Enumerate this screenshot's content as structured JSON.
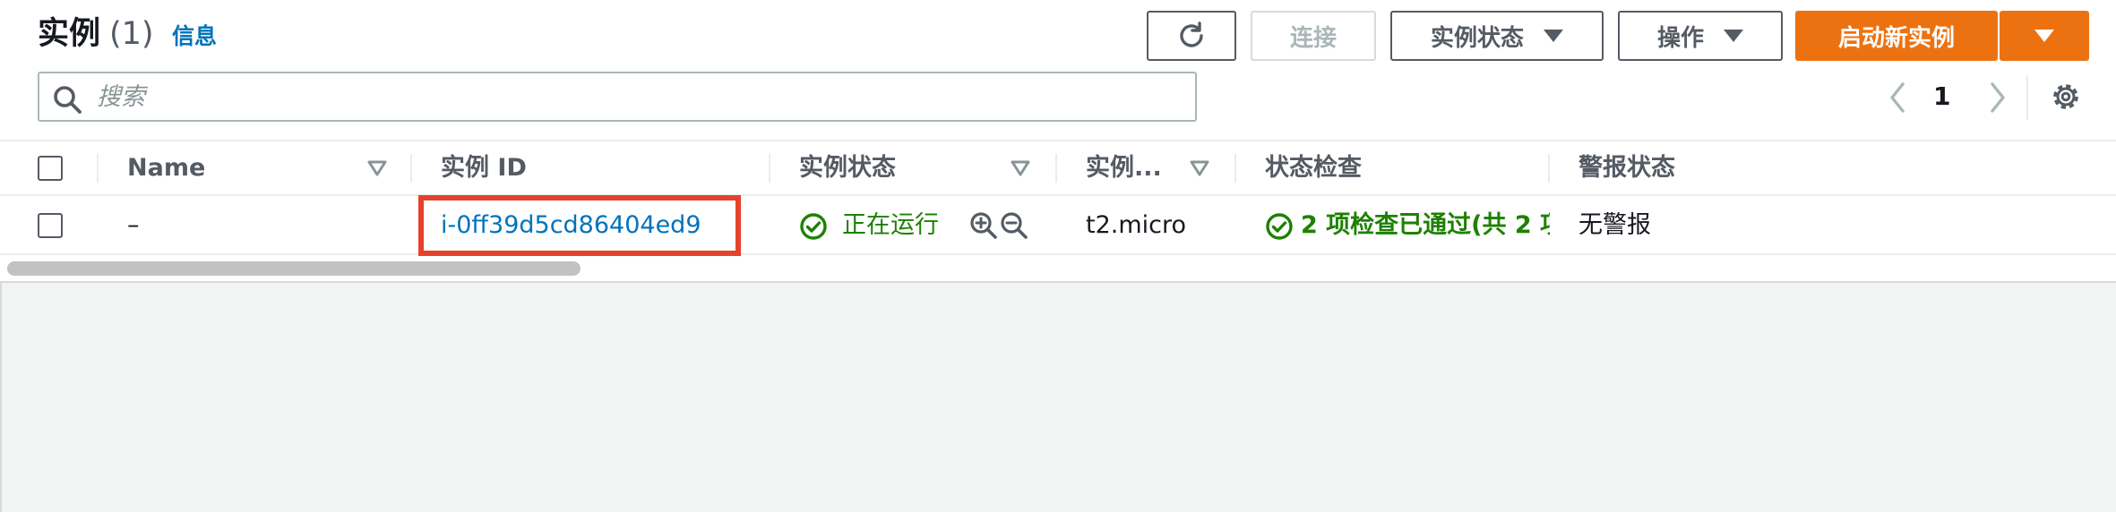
{
  "header": {
    "title": "实例",
    "count": "(1)",
    "info_link": "信息"
  },
  "toolbar": {
    "refresh_icon": "refresh-icon",
    "connect_label": "连接",
    "instance_state_label": "实例状态",
    "actions_label": "操作",
    "launch_label": "启动新实例"
  },
  "search": {
    "placeholder": "搜索",
    "value": ""
  },
  "pagination": {
    "current_page": "1"
  },
  "table": {
    "columns": [
      "Name",
      "实例 ID",
      "实例状态",
      "实例...",
      "状态检查",
      "警报状态"
    ],
    "rows": [
      {
        "name": "–",
        "instance_id": "i-0ff39d5cd86404ed9",
        "state": "正在运行",
        "type": "t2.micro",
        "status_check": "2 项检查已通过(共 2 项",
        "alarm": "无警报"
      }
    ]
  },
  "colors": {
    "accent_orange": "#ec7211",
    "link_blue": "#0073bb",
    "success_green": "#1d8102",
    "highlight_red": "#e8412b"
  }
}
